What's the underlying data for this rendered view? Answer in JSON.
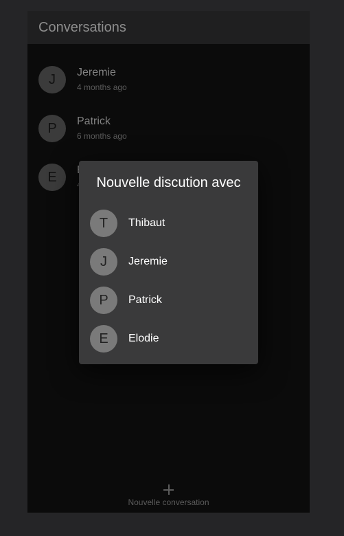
{
  "header": {
    "title": "Conversations"
  },
  "conversations": [
    {
      "avatar": "J",
      "name": "Jeremie",
      "time": "4 months ago"
    },
    {
      "avatar": "P",
      "name": "Patrick",
      "time": "6 months ago"
    },
    {
      "avatar": "E",
      "name": "E",
      "time": "4"
    }
  ],
  "footer": {
    "label": "Nouvelle conversation",
    "icon": "plus-icon"
  },
  "dialog": {
    "title": "Nouvelle discution avec",
    "contacts": [
      {
        "avatar": "T",
        "name": "Thibaut"
      },
      {
        "avatar": "J",
        "name": "Jeremie"
      },
      {
        "avatar": "P",
        "name": "Patrick"
      },
      {
        "avatar": "E",
        "name": "Elodie"
      }
    ]
  }
}
